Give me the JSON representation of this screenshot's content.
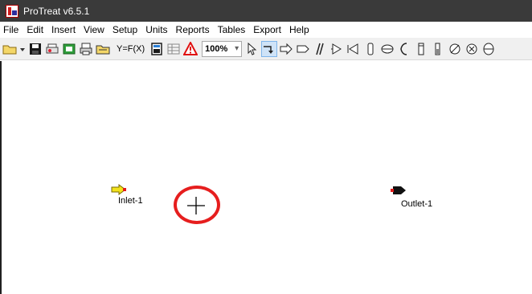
{
  "window": {
    "title": "ProTreat v6.5.1"
  },
  "menu": [
    "File",
    "Edit",
    "Insert",
    "View",
    "Setup",
    "Units",
    "Reports",
    "Tables",
    "Export",
    "Help"
  ],
  "toolbar": {
    "function_label": "Y=F(X)",
    "zoom_value": "100%",
    "zoom_arrow": "▾"
  },
  "canvas": {
    "streams": [
      {
        "label": "Inlet-1",
        "kind": "inlet",
        "color": "#f2e21b"
      },
      {
        "label": "Outlet-1",
        "kind": "outlet",
        "color": "#111111"
      }
    ],
    "cursor": {
      "icon": "crosshair-icon",
      "highlight_color": "#e61e1e"
    }
  }
}
